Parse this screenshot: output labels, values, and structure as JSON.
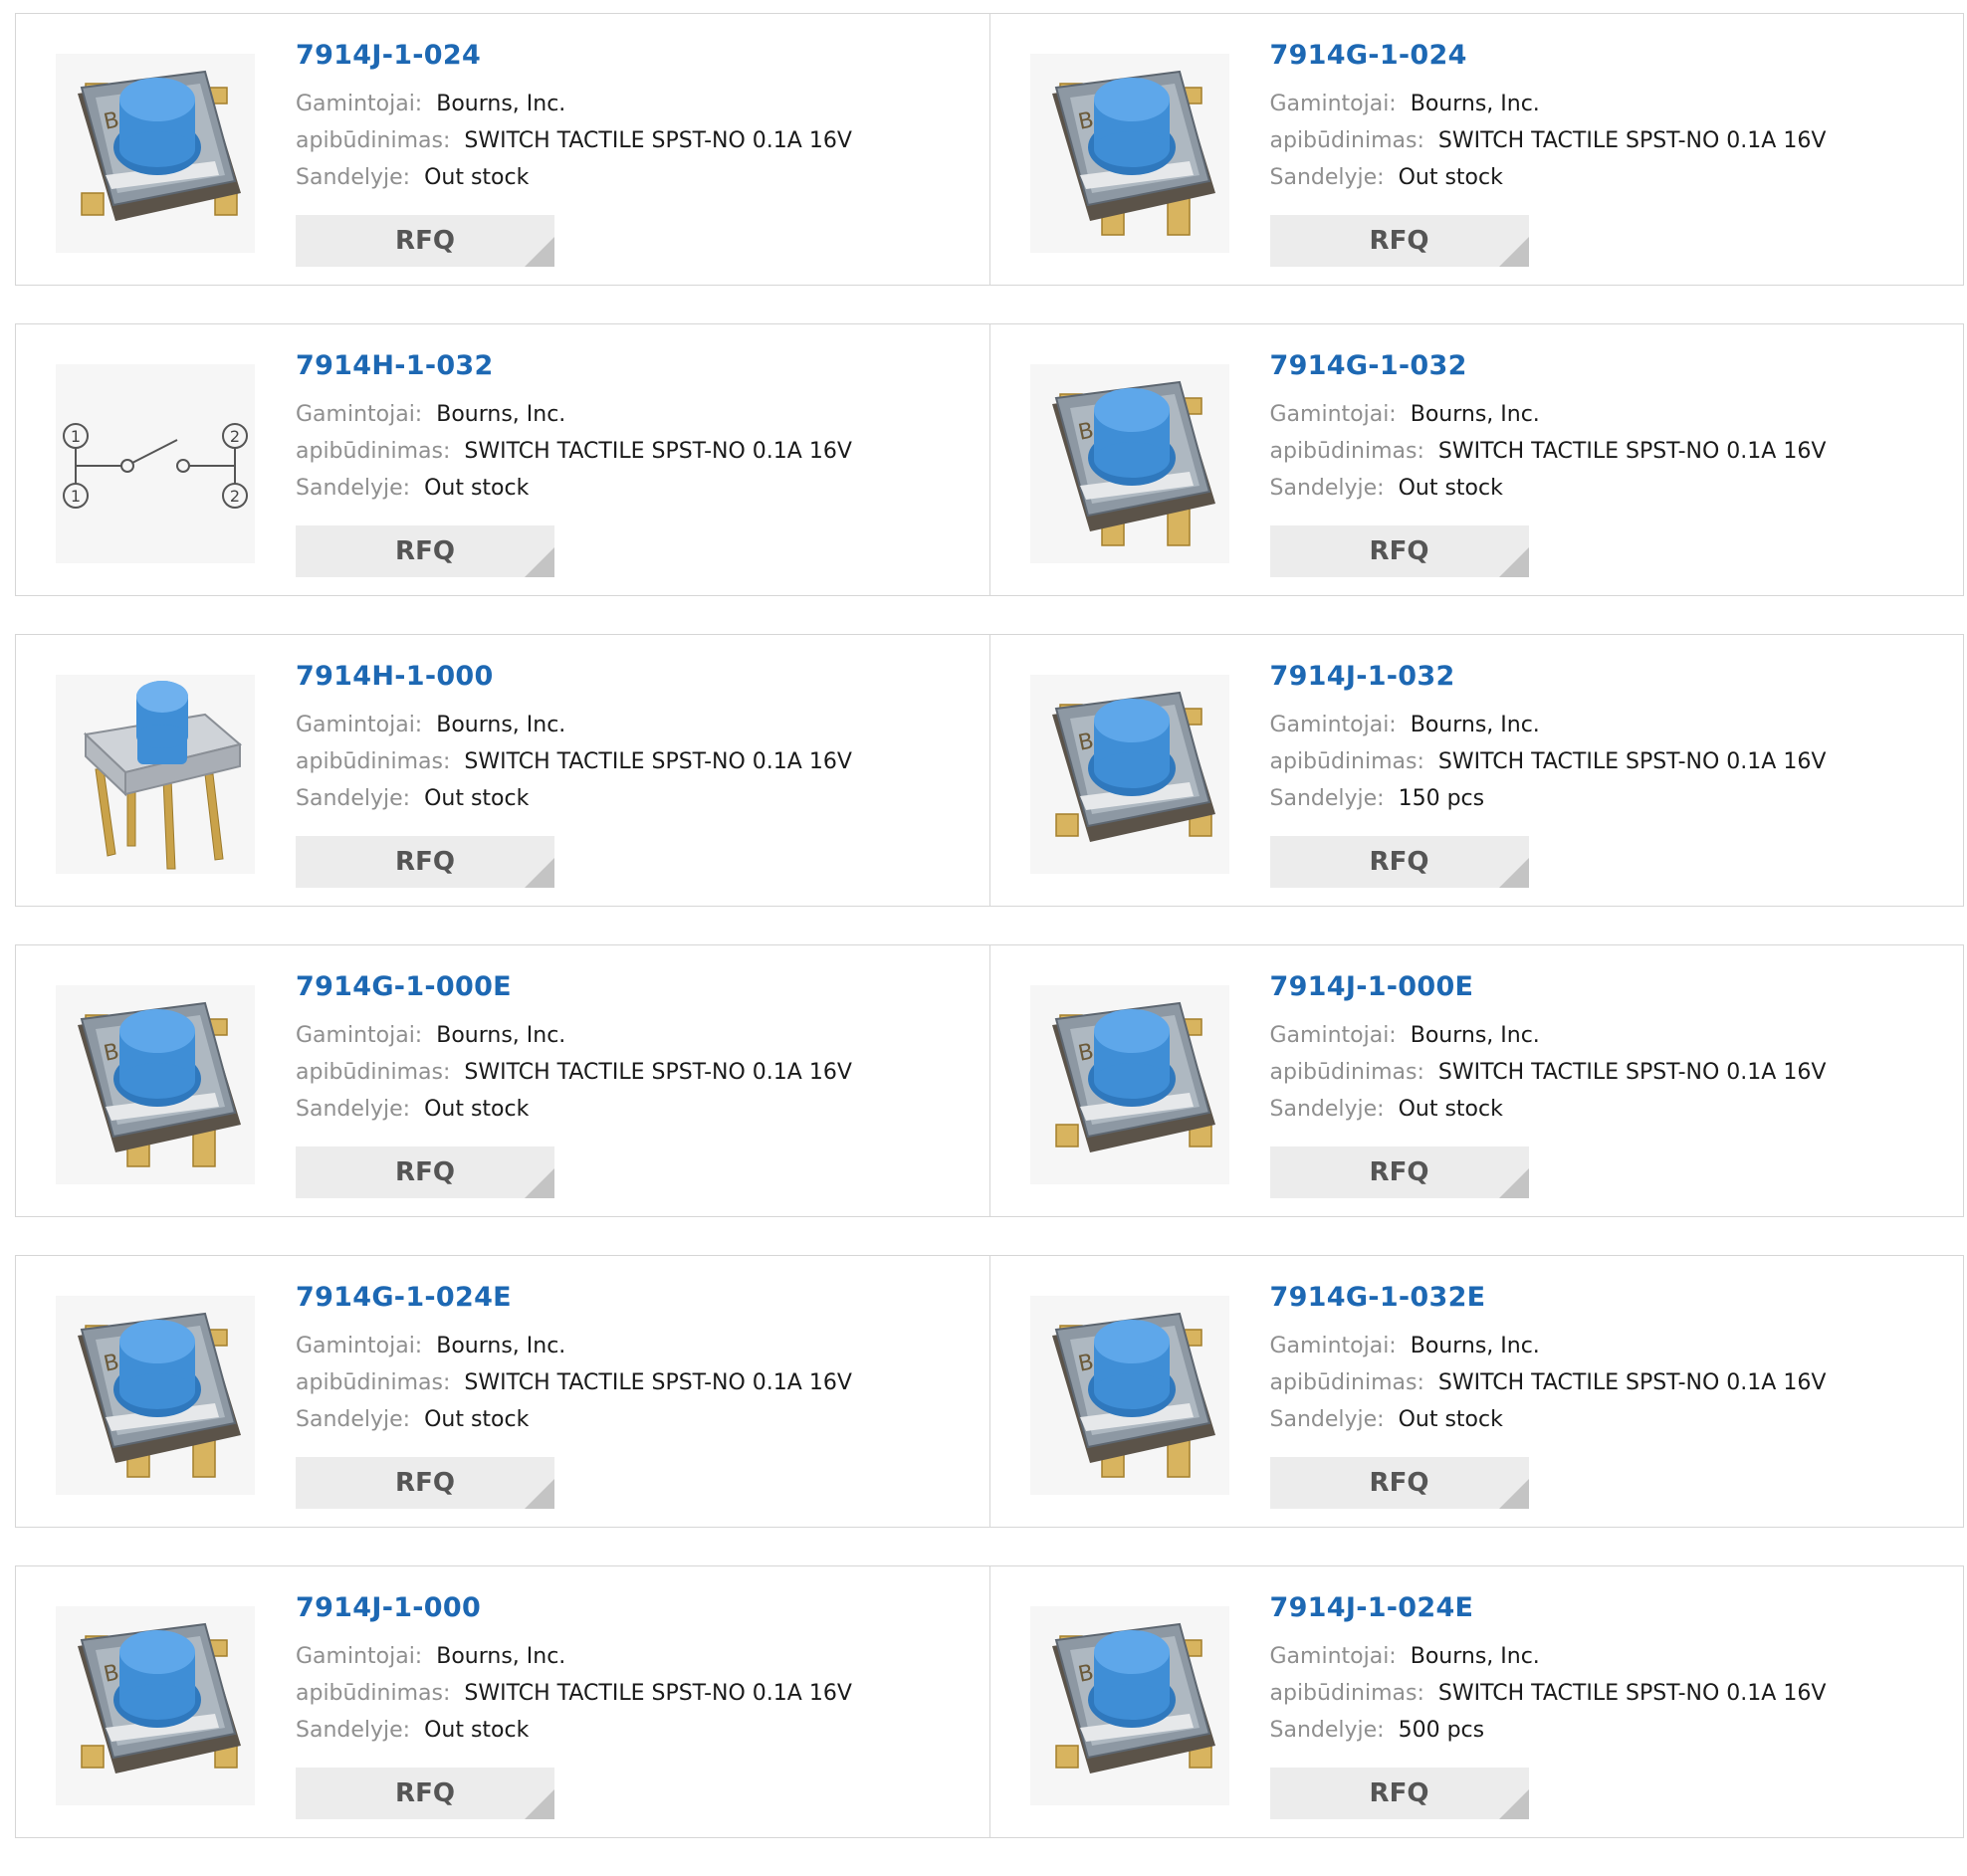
{
  "labels": {
    "manufacturer": "Gamintojai:",
    "description": "apibūdinimas:",
    "stock": "Sandelyje:",
    "rfq": "RFQ"
  },
  "colors": {
    "part_link": "#1d68b3",
    "label_gray": "#8f8f8f",
    "button_bg": "#ececec",
    "switch_cap_blue": "#3f8ed6"
  },
  "products": [
    {
      "part": "7914J-1-024",
      "manufacturer": "Bourns, Inc.",
      "description": "SWITCH TACTILE SPST-NO 0.1A 16V",
      "stock": "Out stock",
      "image": "tactile-switch-short-leads"
    },
    {
      "part": "7914G-1-024",
      "manufacturer": "Bourns, Inc.",
      "description": "SWITCH TACTILE SPST-NO 0.1A 16V",
      "stock": "Out stock",
      "image": "tactile-switch-long-leads"
    },
    {
      "part": "7914H-1-032",
      "manufacturer": "Bourns, Inc.",
      "description": "SWITCH TACTILE SPST-NO 0.1A 16V",
      "stock": "Out stock",
      "image": "switch-schematic"
    },
    {
      "part": "7914G-1-032",
      "manufacturer": "Bourns, Inc.",
      "description": "SWITCH TACTILE SPST-NO 0.1A 16V",
      "stock": "Out stock",
      "image": "tactile-switch-long-leads"
    },
    {
      "part": "7914H-1-000",
      "manufacturer": "Bourns, Inc.",
      "description": "SWITCH TACTILE SPST-NO 0.1A 16V",
      "stock": "Out stock",
      "image": "tactile-switch-through-hole"
    },
    {
      "part": "7914J-1-032",
      "manufacturer": "Bourns, Inc.",
      "description": "SWITCH TACTILE SPST-NO 0.1A 16V",
      "stock": "150 pcs",
      "image": "tactile-switch-short-leads"
    },
    {
      "part": "7914G-1-000E",
      "manufacturer": "Bourns, Inc.",
      "description": "SWITCH TACTILE SPST-NO 0.1A 16V",
      "stock": "Out stock",
      "image": "tactile-switch-long-leads"
    },
    {
      "part": "7914J-1-000E",
      "manufacturer": "Bourns, Inc.",
      "description": "SWITCH TACTILE SPST-NO 0.1A 16V",
      "stock": "Out stock",
      "image": "tactile-switch-short-leads"
    },
    {
      "part": "7914G-1-024E",
      "manufacturer": "Bourns, Inc.",
      "description": "SWITCH TACTILE SPST-NO 0.1A 16V",
      "stock": "Out stock",
      "image": "tactile-switch-long-leads"
    },
    {
      "part": "7914G-1-032E",
      "manufacturer": "Bourns, Inc.",
      "description": "SWITCH TACTILE SPST-NO 0.1A 16V",
      "stock": "Out stock",
      "image": "tactile-switch-long-leads"
    },
    {
      "part": "7914J-1-000",
      "manufacturer": "Bourns, Inc.",
      "description": "SWITCH TACTILE SPST-NO 0.1A 16V",
      "stock": "Out stock",
      "image": "tactile-switch-short-leads"
    },
    {
      "part": "7914J-1-024E",
      "manufacturer": "Bourns, Inc.",
      "description": "SWITCH TACTILE SPST-NO 0.1A 16V",
      "stock": "500 pcs",
      "image": "tactile-switch-short-leads"
    }
  ]
}
